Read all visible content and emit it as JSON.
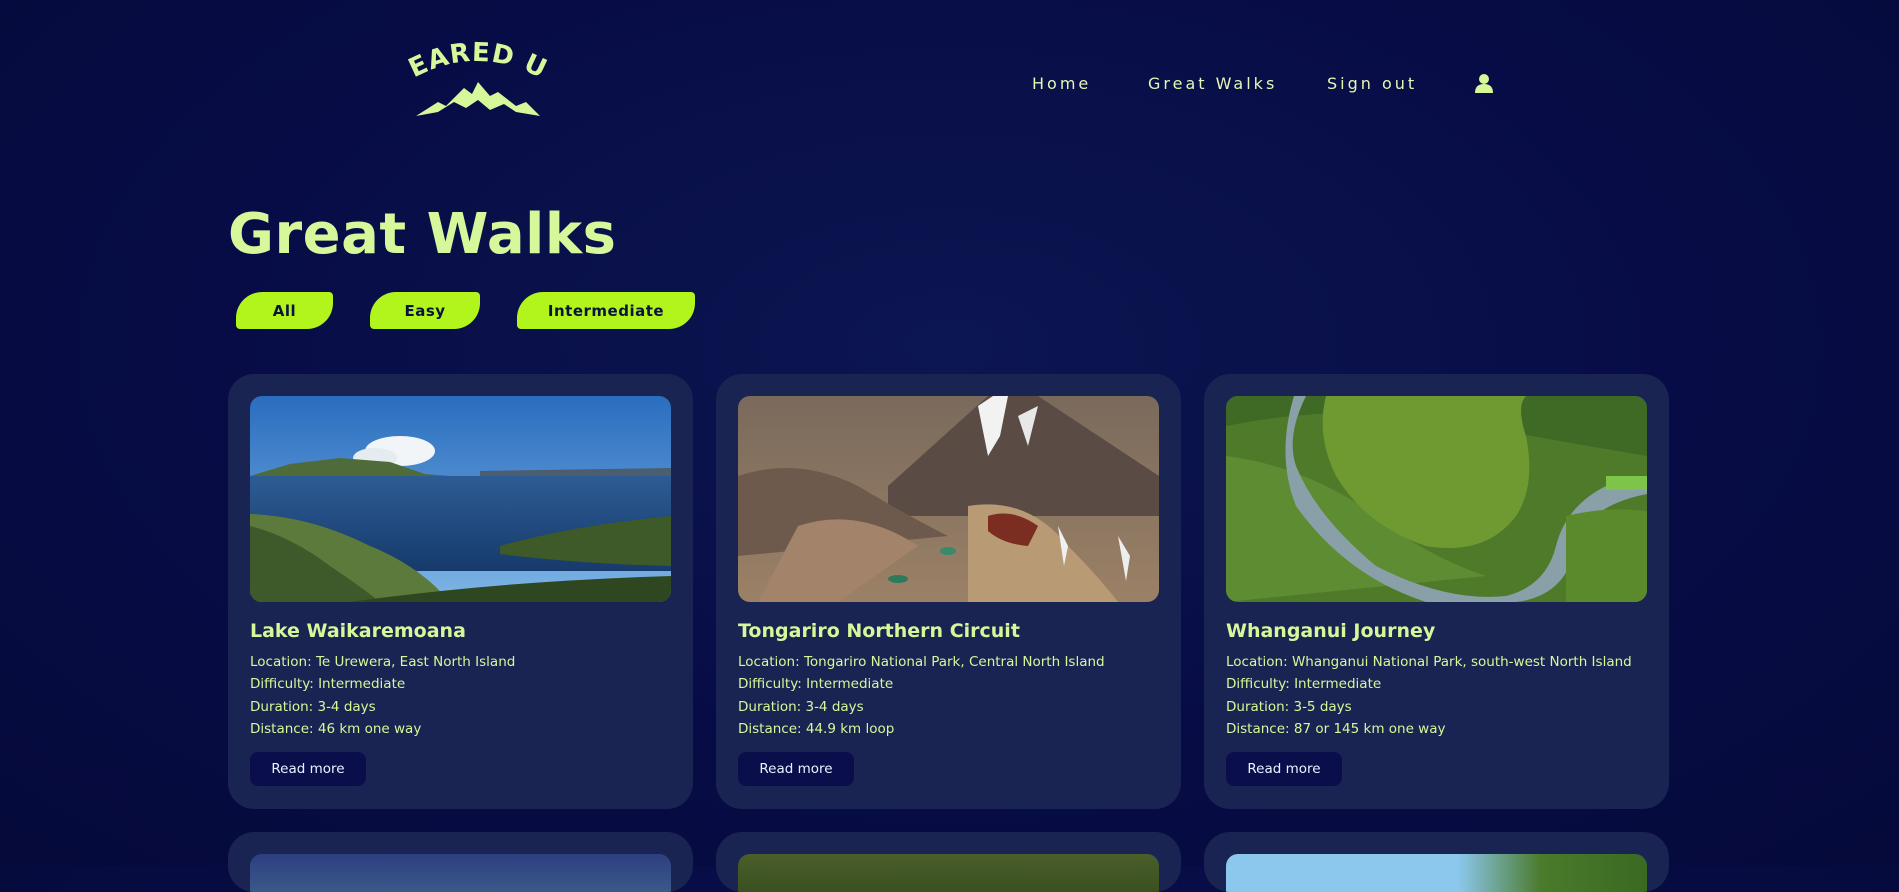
{
  "header": {
    "logo_text": "GEARED UP",
    "nav": [
      {
        "label": "Home"
      },
      {
        "label": "Great Walks"
      },
      {
        "label": "Sign out"
      }
    ],
    "user_icon": "user-icon"
  },
  "main": {
    "title": "Great Walks",
    "filters": [
      {
        "label": "All"
      },
      {
        "label": "Easy"
      },
      {
        "label": "Intermediate"
      }
    ],
    "cards": [
      {
        "title": "Lake Waikaremoana",
        "location": "Location: Te Urewera, East North Island",
        "difficulty": "Difficulty: Intermediate",
        "duration": "Duration: 3-4 days",
        "distance": "Distance: 46 km one way",
        "button": "Read more"
      },
      {
        "title": "Tongariro Northern Circuit",
        "location": "Location: Tongariro National Park, Central North Island",
        "difficulty": "Difficulty: Intermediate",
        "duration": "Duration: 3-4 days",
        "distance": "Distance: 44.9 km loop",
        "button": "Read more"
      },
      {
        "title": "Whanganui Journey",
        "location": "Location: Whanganui National Park, south-west North Island",
        "difficulty": "Difficulty: Intermediate",
        "duration": "Duration: 3-5 days",
        "distance": "Distance: 87 or 145 km one way",
        "button": "Read more"
      }
    ]
  },
  "colors": {
    "background": "#070c46",
    "accent": "#b2f51c",
    "text": "#d6f79a",
    "card": "#1a2452",
    "button": "#0a0f4c"
  }
}
